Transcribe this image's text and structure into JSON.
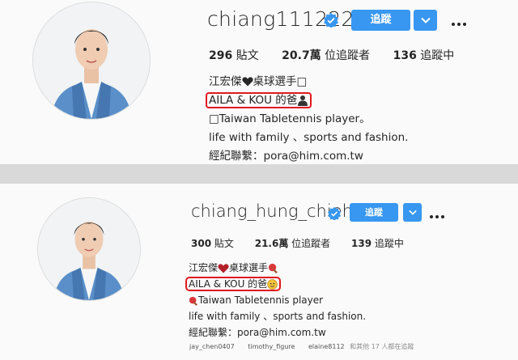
{
  "panels": [
    {
      "username": "chiang111222",
      "follow_label": "追蹤",
      "stats": [
        {
          "value": "296",
          "label": "貼文"
        },
        {
          "value": "20.7萬",
          "label": "位追蹤者"
        },
        {
          "value": "136",
          "label": "追蹤中"
        }
      ],
      "bio": {
        "line1_name": "江宏傑",
        "line1_rest": "桌球選手",
        "line1_end": "□",
        "highlight": "AILA & KOU 的爸",
        "line3": "□Taiwan Tabletennis player。",
        "line4": "life with family 、sports and fashion.",
        "line5": "經紀聯繫：pora@him.com.tw"
      }
    },
    {
      "username": "chiang_hung_chieh",
      "follow_label": "追蹤",
      "stats": [
        {
          "value": "300",
          "label": "貼文"
        },
        {
          "value": "21.6萬",
          "label": "位追蹤者"
        },
        {
          "value": "139",
          "label": "追蹤中"
        }
      ],
      "bio": {
        "line1_name": "江宏傑",
        "line1_rest": "桌球選手",
        "highlight": "AILA & KOU 的爸",
        "line3": "Taiwan Tabletennis player",
        "line4": "life with family 、sports and fashion.",
        "line5": "經紀聯繫：pora@him.com.tw"
      },
      "followed_by": {
        "users": [
          "jay_chen0407",
          "timothy_figure",
          "elaine8112"
        ],
        "suffix": "和其他 17 人都在追蹤"
      }
    }
  ],
  "colors": {
    "follow_button": "#3897f0",
    "highlight_border": "#e0191e",
    "verified_badge": "#3897f0"
  },
  "icons": [
    "verified-badge-icon",
    "chevron-down-icon",
    "more-options-icon",
    "heart-icon",
    "ping-pong-paddle-icon",
    "person-icon",
    "face-emoji-icon"
  ]
}
